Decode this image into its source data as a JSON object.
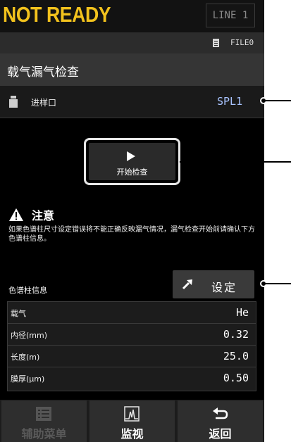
{
  "header": {
    "status": "NOT READY",
    "status_color": "#f2c21d",
    "line_button": "LINE 1",
    "file_icon": "file-list-icon",
    "file_label": "FILE0"
  },
  "page": {
    "title": "载气漏气检查"
  },
  "port": {
    "icon": "injector-icon",
    "label": "进样口",
    "value": "SPL1"
  },
  "start": {
    "icon": "play-icon",
    "label": "开始检查"
  },
  "warning": {
    "icon": "warning-triangle-icon",
    "title": "注意",
    "text": "如果色谱柱尺寸设定错误将不能正确反映漏气情况，漏气检查开始前请确认下方色谱柱信息。"
  },
  "settings": {
    "icon": "arrow-icon",
    "label": "设定"
  },
  "column": {
    "title": "色谱柱信息",
    "rows": [
      {
        "label": "载气",
        "value": "He"
      },
      {
        "label": "内径(mm)",
        "value": "0.32"
      },
      {
        "label": "长度(m)",
        "value": "25.0"
      },
      {
        "label": "膜厚(μm)",
        "value": "0.50"
      }
    ]
  },
  "nav": {
    "assist_menu": {
      "label": "辅助菜单",
      "icon": "list-icon",
      "enabled": false
    },
    "monitor": {
      "label": "监视",
      "icon": "chromatogram-icon",
      "enabled": true
    },
    "back": {
      "label": "返回",
      "icon": "return-arrow-icon",
      "enabled": true
    }
  }
}
